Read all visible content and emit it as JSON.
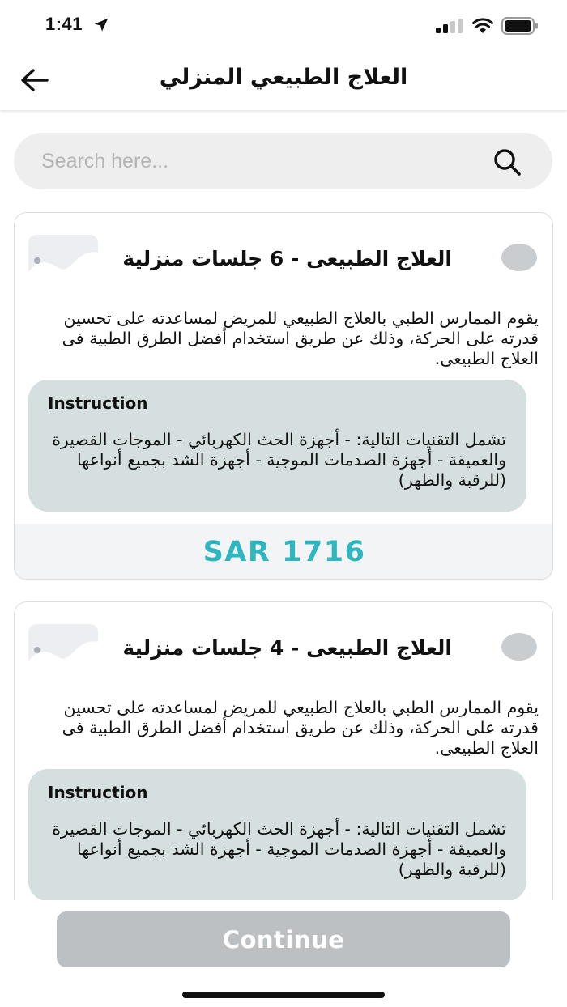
{
  "status_bar": {
    "time": "1:41",
    "icons": [
      "location-arrow-icon",
      "signal-icon",
      "wifi-icon",
      "battery-icon"
    ]
  },
  "header": {
    "title": "العلاج الطبيعي المنزلي",
    "back_icon": "back-arrow-icon"
  },
  "search": {
    "placeholder": "Search here...",
    "icon": "search-icon"
  },
  "packages": [
    {
      "title": "العلاج الطبيعى - 6 جلسات منزلية",
      "description": "يقوم الممارس الطبي بالعلاج الطبيعي للمريض لمساعدته على تحسين قدرته على الحركة، وذلك عن طريق استخدام أفضل الطرق الطبية فى العلاج الطبيعى.",
      "instruction_title": "Instruction",
      "instruction_text": "تشمل التقنيات التالية: - أجهزة الحث الكهربائي - الموجات القصيرة والعميقة - أجهزة الصدمات الموجية - أجهزة الشد بجميع أنواعها (للرقبة والظهر)",
      "price": "SAR 1716",
      "selected": false
    },
    {
      "title": "العلاج الطبيعى - 4 جلسات منزلية",
      "description": "يقوم الممارس الطبي بالعلاج الطبيعي للمريض لمساعدته على تحسين قدرته على الحركة، وذلك عن طريق استخدام أفضل الطرق الطبية فى العلاج الطبيعى.",
      "instruction_title": "Instruction",
      "instruction_text": "تشمل التقنيات التالية: - أجهزة الحث الكهربائي - الموجات القصيرة والعميقة - أجهزة الصدمات الموجية - أجهزة الشد بجميع أنواعها (للرقبة والظهر)",
      "selected": false
    }
  ],
  "footer": {
    "continue_label": "Continue"
  },
  "colors": {
    "accent": "#2fb6be",
    "instruction_bg": "#d5dfe0",
    "button_disabled": "#bdc0c3",
    "radio": "#cacdd0"
  }
}
